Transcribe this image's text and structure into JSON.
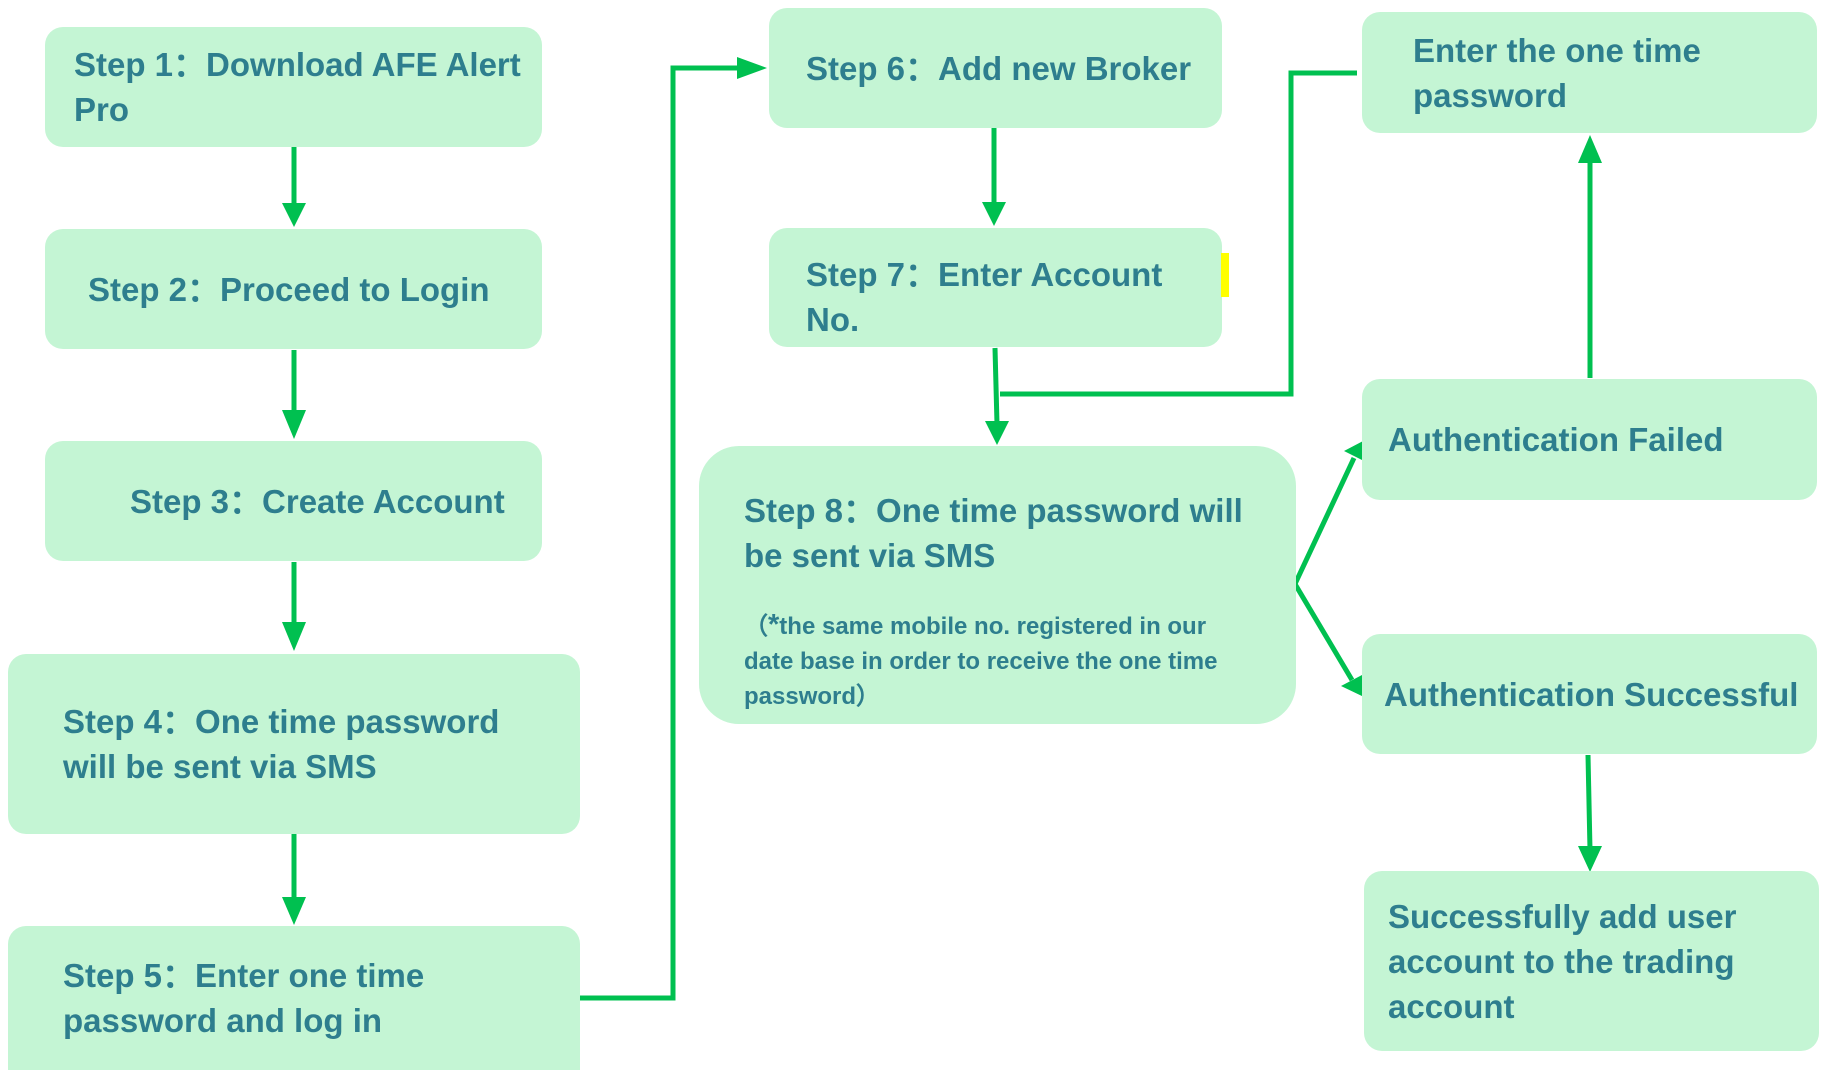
{
  "nodes": {
    "step1": "Step 1：Download AFE Alert Pro",
    "step2": "Step 2：Proceed to Login",
    "step3": "Step 3：Create Account",
    "step4": "Step 4：One time password will be sent via SMS",
    "step5": "Step 5：Enter one time password and log in",
    "step6": "Step 6：Add new Broker",
    "step7": "Step 7：Enter Account No.",
    "step8": "Step 8：One time password will be sent via SMS",
    "step8_note_open": "（",
    "step8_note_star": "*",
    "step8_note": "the same mobile no. registered in our date base in order to receive the one time password）",
    "enter_otp": "Enter the one time password",
    "auth_failed": "Authentication Failed",
    "auth_success": "Authentication Successful",
    "success_add": "Successfully add user account to the trading account"
  },
  "colors": {
    "box_fill": "#c4f5d4",
    "text": "#2e7e8e",
    "arrow": "#00c050",
    "highlight": "#ffff00"
  }
}
